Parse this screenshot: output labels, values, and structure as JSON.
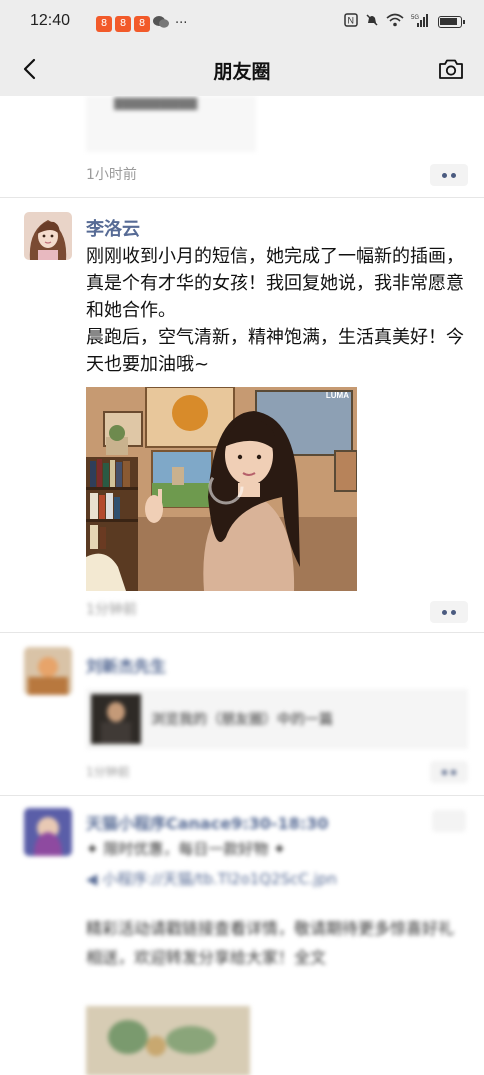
{
  "status_bar": {
    "time": "12:40",
    "notif_badges": [
      "8",
      "8",
      "8"
    ],
    "more": "···",
    "network": "5G"
  },
  "nav": {
    "title": "朋友圈",
    "back_icon": "chevron-left-icon",
    "camera_icon": "camera-icon"
  },
  "posts": {
    "p0": {
      "time": "1小时前",
      "preview_text": "▇▇▇▇▇▇▇▇▇"
    },
    "p1": {
      "author": "李洛云",
      "text": "刚刚收到小月的短信，她完成了一幅新的插画，真是个有才华的女孩！我回复她说，我非常愿意和她合作。\n晨跑后，空气清新，精神饱满，生活真美好！今天也要加油哦~",
      "image_watermark": "LUMA",
      "time": "1分钟前"
    },
    "p2": {
      "author": "刘新杰先生",
      "link_text": "浏览我的（朋友圈）中的一篇",
      "time": "1分钟前"
    },
    "p3": {
      "author": "天猫小程序Canace9:30-18:30",
      "line1": "✦ 限时优惠，每日一款好物 ✦",
      "line2": "◀ 小程序://天猫/tb.Tl2o1Q2ScC.jpn",
      "line3": "精彩活动请戳链接查看详情，敬请期待更多惊喜好礼相送，欢迎转发分享给大家！全文"
    }
  }
}
